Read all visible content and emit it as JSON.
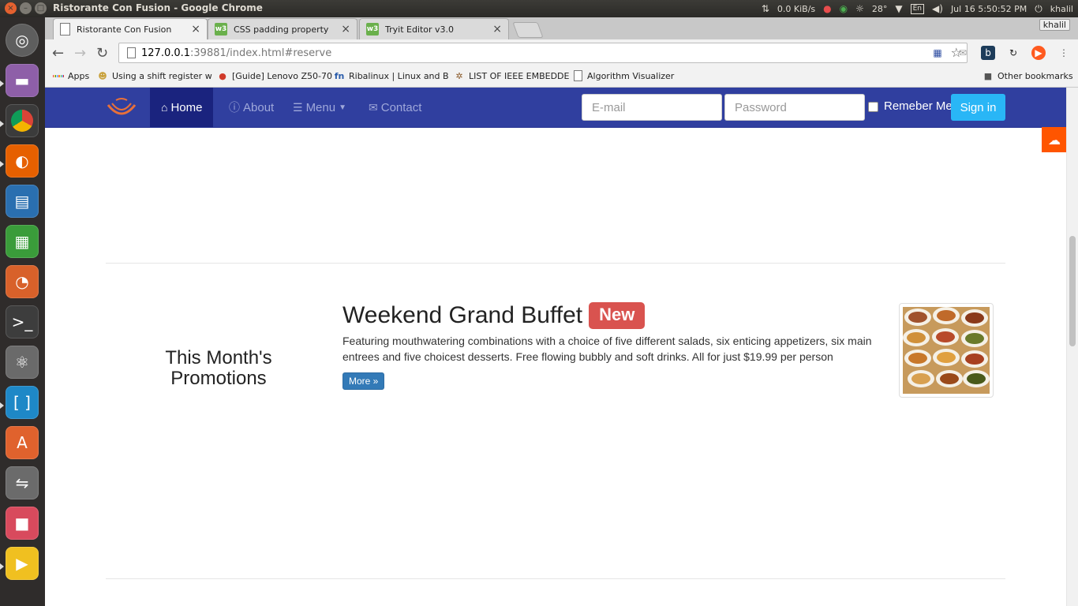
{
  "system": {
    "window_title": "Ristorante Con Fusion - Google Chrome",
    "net_speed": "0.0 KiB/s",
    "temperature": "28°",
    "keyboard": "En",
    "datetime": "Jul 16  5:50:52 PM",
    "user": "khalil"
  },
  "browser": {
    "tabs": [
      {
        "label": "Ristorante Con Fusion",
        "icon": "document-icon",
        "active": true
      },
      {
        "label": "CSS padding property",
        "icon": "w3-icon",
        "active": false
      },
      {
        "label": "Tryit Editor v3.0",
        "icon": "w3-icon",
        "active": false
      }
    ],
    "profile": "khalil",
    "url_host": "127.0.0.1",
    "url_rest": ":39881/index.html#reserve",
    "bookmarks": [
      {
        "label": "Apps",
        "icon": "apps-grid-icon"
      },
      {
        "label": "Using a shift register w",
        "icon": "avatar-icon"
      },
      {
        "label": "[Guide] Lenovo Z50-70",
        "icon": "tomato-icon"
      },
      {
        "label": "Ribalinux | Linux and B",
        "icon": "fn-icon"
      },
      {
        "label": "LIST OF IEEE EMBEDDE",
        "icon": "chip-icon"
      },
      {
        "label": "Algorithm Visualizer",
        "icon": "document-icon"
      }
    ],
    "other_bookmarks": "Other bookmarks"
  },
  "site": {
    "nav": {
      "home": "Home",
      "about": "About",
      "menu": "Menu",
      "contact": "Contact"
    },
    "login": {
      "email_placeholder": "E-mail",
      "password_placeholder": "Password",
      "remember": "Remeber Me",
      "signin": "Sign in"
    },
    "promotion": {
      "heading_line1": "This Month's",
      "heading_line2": "Promotions",
      "title": "Weekend Grand Buffet",
      "badge": "New",
      "description": "Featuring mouthwatering combinations with a choice of five different salads, six enticing appetizers, six main entrees and five choicest desserts. Free flowing bubbly and soft drinks. All for just $19.99 per person",
      "more_button": "More »"
    }
  },
  "colors": {
    "navbar": "#303f9f",
    "navbar_active": "#1a237e",
    "signin": "#29b6f6",
    "badge": "#d9534f",
    "more_button": "#337ab7",
    "soundcloud": "#ff5500"
  }
}
